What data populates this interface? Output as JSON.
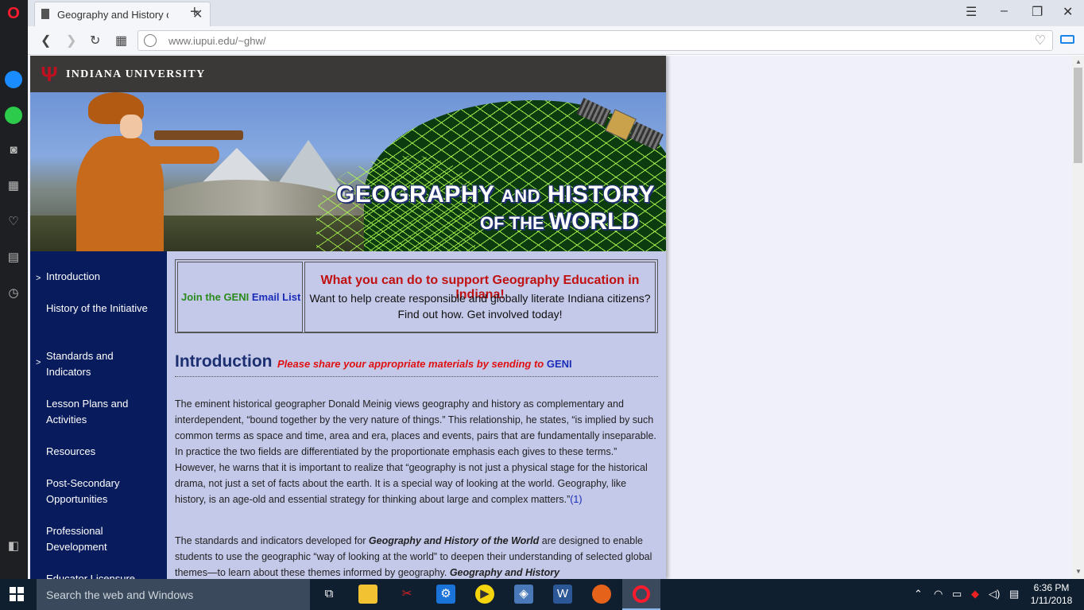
{
  "browser": {
    "tab_title": "Geography and History of",
    "url": "www.iupui.edu/~ghw/",
    "new_tab_symbol": "+",
    "close_tab_symbol": "✕",
    "logo": "O"
  },
  "site": {
    "university": "INDIANA UNIVERSITY",
    "banner_line1_a": "GEOGRAPHY ",
    "banner_line1_b": "AND",
    "banner_line1_c": " HISTORY",
    "banner_line2_a": "OF THE ",
    "banner_line2_b": "WORLD"
  },
  "nav": {
    "items": [
      {
        "label": "Introduction",
        "arrow": ">"
      },
      {
        "label": "History of the Initiative",
        "arrow": ""
      },
      {
        "label": "Standards and Indicators",
        "arrow": ">"
      },
      {
        "label": "Lesson Plans and Activities",
        "arrow": ""
      },
      {
        "label": "Resources",
        "arrow": ""
      },
      {
        "label": "Post-Secondary Opportunities",
        "arrow": ""
      },
      {
        "label": "Professional Development",
        "arrow": ""
      },
      {
        "label": "Educator Licensure",
        "arrow": ""
      }
    ]
  },
  "geni_box": {
    "join_text": "Join the GENI",
    "email_list": "Email List",
    "headline": "What you can do to support Geography Education in Indiana!",
    "line1": "Want to help create responsible and globally literate Indiana citizens?",
    "line2": "Find out how.  Get involved today!"
  },
  "intro": {
    "heading": "Introduction",
    "note": "Please share your appropriate materials by sending to ",
    "note_link": "GENI",
    "para1": "The eminent historical geographer Donald Meinig views geography and history as complementary and interdependent, “bound together by the very nature of things.” This relationship, he states, “is implied by such common terms as space and time, area and era, places and events, pairs that are fundamentally inseparable. In practice the two fields are differentiated by the proportionate emphasis each gives to these terms.” However, he warns that it is important to realize that “geography is not just a physical stage for the historical drama, not just a set of facts about the earth. It is a special way of looking at the world. Geography, like history, is an age-old and essential strategy for thinking about large and complex matters.”",
    "para1_ref": "(1)",
    "para2_a": "The standards and indicators developed for ",
    "para2_em": "Geography and History of the World",
    "para2_b": " are designed to enable students to use the geographic “way of looking at the world” to deepen their understanding of selected global themes—to learn about these themes informed by geography. ",
    "para2_em2": "Geography and History"
  },
  "taskbar": {
    "search_placeholder": "Search the web and Windows",
    "time": "6:36 PM",
    "date": "1/11/2018"
  }
}
